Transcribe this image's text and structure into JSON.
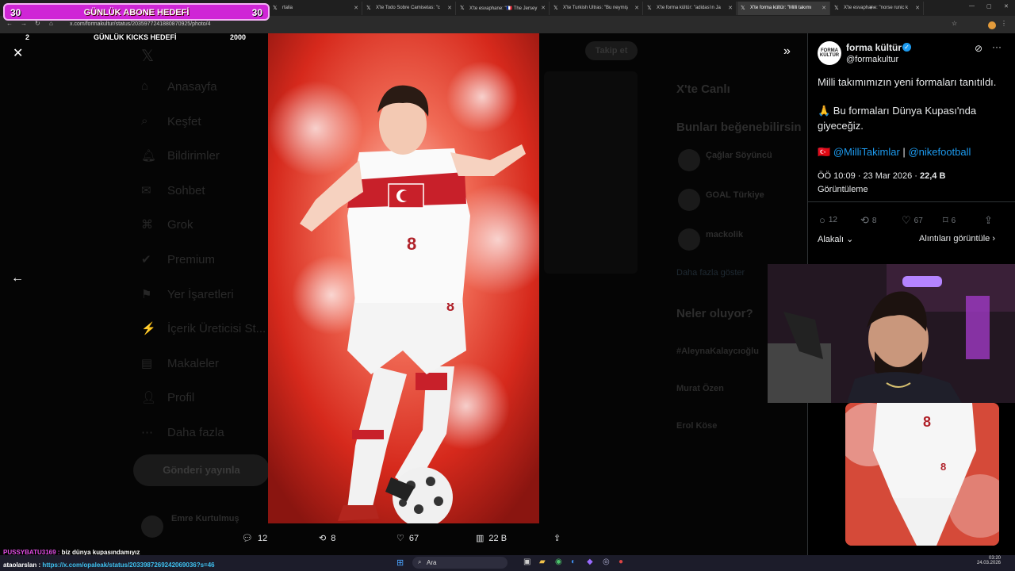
{
  "overlay": {
    "sub_left": "30",
    "sub_title": "GÜNLÜK ABONE HEDEFİ",
    "sub_right": "30",
    "kicks_left": "2",
    "kicks_title": "GÜNLÜK KICKS HEDEFİ",
    "kicks_right": "2000"
  },
  "browser": {
    "tabs": [
      "rtalia",
      "X'te Todo Sobre Camisetas: \"c",
      "X'te esvaphane: \"🇫🇷 The Jersey",
      "X'te Turkish Ultras: \"Bu neymiş",
      "X'te forma kültür: \"adidas'ın Ja",
      "X'te forma kültür: \"Milli takımı",
      "X'te esvaphane: \"norse runic k"
    ],
    "url": "x.com/formakultur/status/2035977241880870925/photo/4"
  },
  "sidebar": [
    "Anasayfa",
    "Keşfet",
    "Bildirimler",
    "Sohbet",
    "Grok",
    "Premium",
    "Yer İşaretleri",
    "İçerik Üreticisi St...",
    "Makaleler",
    "Profil",
    "Daha fazla"
  ],
  "sidebar_post_button": "Gönderi yayınla",
  "sidebar_user": "Emre Kurtulmuş",
  "right_bg": {
    "follow": "Takip et",
    "live": "X'te Canlı",
    "suggest": "Bunları beğenebilirsin",
    "users": [
      "Çağlar Söyüncü",
      "GOAL Türkiye",
      "mackolik"
    ],
    "more": "Daha fazla göster",
    "happening": "Neler oluyor?",
    "trends": [
      "#AleynaKalaycıoğlu",
      "Murat Özen",
      "Erol Köse"
    ]
  },
  "tweet": {
    "name": "forma kültür",
    "handle": "@formakultur",
    "avatar_text": "FORMA KÜLTÜR",
    "line1": "Milli takımımızın yeni formaları tanıtıldı.",
    "line2": "🙏 Bu formaları Dünya Kupası'nda giyeceğiz.",
    "mention1": "@MilliTakimlar",
    "separator": "|",
    "mention2": "@nikefootball",
    "time": "ÖÖ 10:09 · 23 Mar 2026 ·",
    "views": "22,4 B",
    "views_label": "Görüntüleme",
    "replies": "12",
    "retweets": "8",
    "likes": "67",
    "bookmarks": "6",
    "sort": "Alakalı",
    "quotes": "Alıntıları görüntüle"
  },
  "photo_actions": {
    "replies": "12",
    "retweets": "8",
    "likes": "67",
    "views": "22 B"
  },
  "chat": {
    "user1": "PUSSYBATU3169 :",
    "msg1": "biz dünya kupasındamıyız",
    "user2": "ataolarslan :",
    "msg2": "https://x.com/opaleak/status/2033987269242069036?s=46"
  },
  "taskbar": {
    "search": "Ara",
    "time": "03:20",
    "date": "24.03.2026"
  },
  "colors": {
    "accent": "#1d9bf0",
    "overlay": "#cf25d6",
    "jersey_red": "#e0322b"
  }
}
